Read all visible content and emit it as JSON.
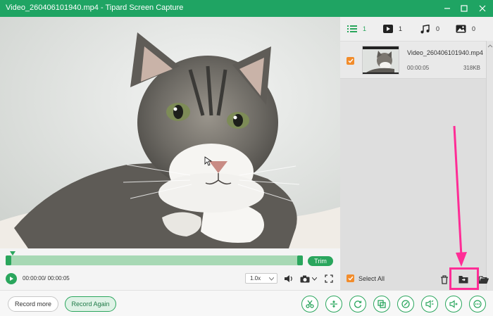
{
  "window": {
    "title": "Video_260406101940.mp4  -  Tipard Screen Capture"
  },
  "tabs": [
    {
      "count": "1",
      "icon": "list-icon"
    },
    {
      "count": "1",
      "icon": "play-icon"
    },
    {
      "count": "0",
      "icon": "music-icon"
    },
    {
      "count": "0",
      "icon": "image-icon"
    }
  ],
  "file": {
    "name": "Video_260406101940.mp4",
    "duration": "00:00:05",
    "size": "318KB",
    "checked": true
  },
  "player": {
    "trim_label": "Trim",
    "time": "00:00:00/ 00:00:05",
    "speed": "1.0x"
  },
  "sidebar_footer": {
    "select_all_label": "Select All"
  },
  "footer": {
    "record_more_label": "Record more",
    "record_again_label": "Record Again"
  },
  "colors": {
    "accent": "#1fa463",
    "highlight": "#ff2d96",
    "checkbox": "#f28c2b"
  }
}
